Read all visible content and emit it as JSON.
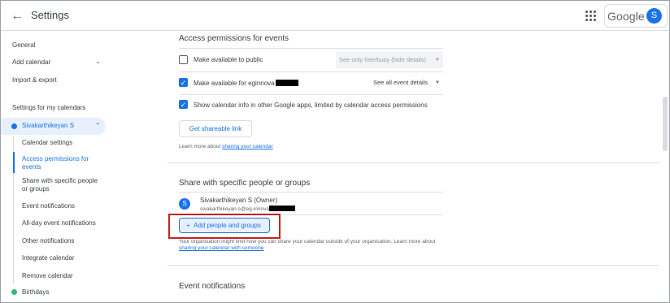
{
  "header": {
    "title": "Settings",
    "brand": "Google",
    "avatar_letter": "S"
  },
  "sidebar": {
    "general": "General",
    "add_calendar": "Add calendar",
    "import_export": "Import & export",
    "section_title": "Settings for my calendars",
    "calendar_name": "Sivakarthikeyan S",
    "calendar_color": "#1a73e8",
    "subitems": [
      "Calendar settings",
      "Access permissions for events",
      "Share with specific people or groups",
      "Event notifications",
      "All-day event notifications",
      "Other notifications",
      "Integrate calendar",
      "Remove calendar"
    ],
    "birthdays": "Birthdays",
    "birthdays_color": "#33b679"
  },
  "access": {
    "heading": "Access permissions for events",
    "make_public_label": "Make available to public",
    "public_select": "See only free/busy (hide details)",
    "make_org_label": "Make available for eginnova",
    "org_select": "See all event details",
    "show_info_label": "Show calendar info in other Google apps, limited by calendar access permissions",
    "shareable_link_button": "Get shareable link",
    "learn_more_prefix": "Learn more about ",
    "learn_more_link": "sharing your calendar"
  },
  "share": {
    "heading": "Share with specific people or groups",
    "owner_avatar": "S",
    "owner_name": "Sivakarthikeyan S (Owner)",
    "owner_email": "sivakarthikeyan.s@eg-innova",
    "add_button": "Add people and groups",
    "org_note": "Your organisation might limit how you can share your calendar outside of your organisation. Learn more about",
    "org_note_link": "sharing your calendar with someone"
  },
  "notifications": {
    "heading": "Event notifications"
  },
  "colors": {
    "accent": "#1a73e8",
    "highlight": "#c5221f"
  }
}
